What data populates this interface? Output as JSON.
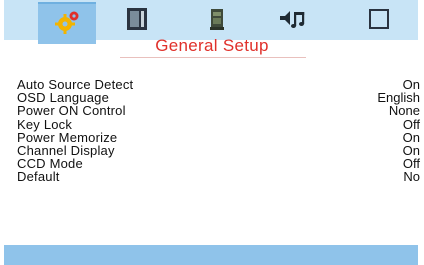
{
  "header": {
    "tabs": [
      {
        "icon": "gear-icon",
        "active": true
      },
      {
        "icon": "tv-screen-icon",
        "active": false
      },
      {
        "icon": "speaker-icon",
        "active": false
      },
      {
        "icon": "music-note-icon",
        "active": false
      },
      {
        "icon": "square-frame-icon",
        "active": false
      }
    ],
    "title": "General Setup",
    "accent": "#e0302a",
    "tab_bar_color": "#c8e4f6",
    "active_tab_color": "#8fc3ea"
  },
  "settings": [
    {
      "label": "Auto Source Detect",
      "value": "On"
    },
    {
      "label": "OSD Language",
      "value": "English"
    },
    {
      "label": "Power ON Control",
      "value": "None"
    },
    {
      "label": "Key Lock",
      "value": "Off"
    },
    {
      "label": "Power Memorize",
      "value": "On"
    },
    {
      "label": "Channel Display",
      "value": "On"
    },
    {
      "label": "CCD Mode",
      "value": "Off"
    },
    {
      "label": "Default",
      "value": "No"
    }
  ]
}
